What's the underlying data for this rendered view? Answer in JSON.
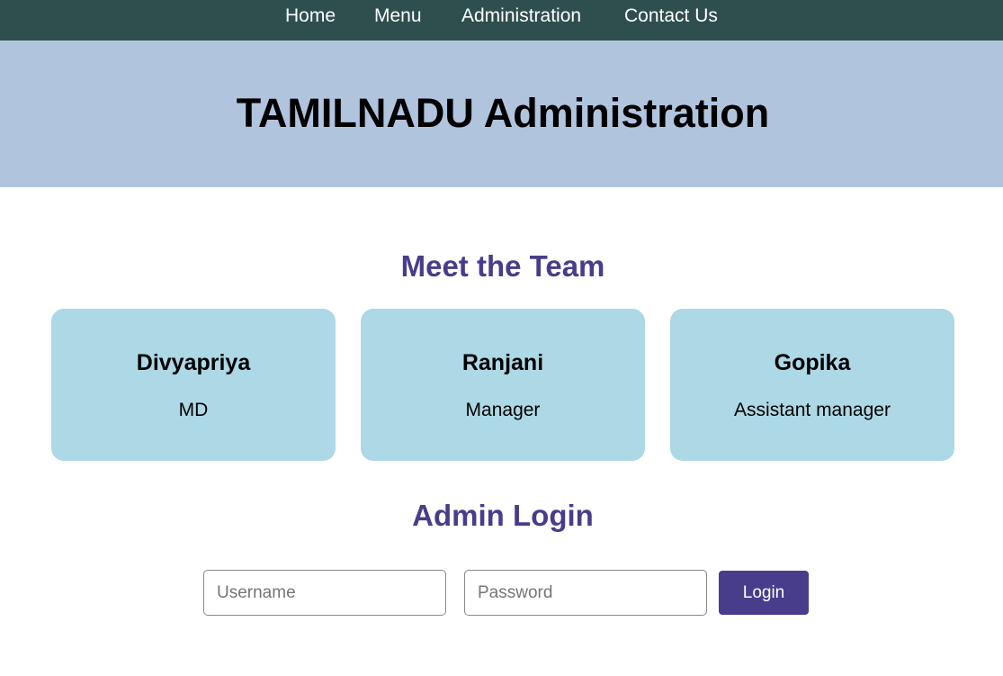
{
  "nav": {
    "items": [
      {
        "label": "Home"
      },
      {
        "label": "Menu"
      },
      {
        "label": "Administration"
      },
      {
        "label": "Contact Us"
      }
    ]
  },
  "hero": {
    "title": "TAMILNADU Administration"
  },
  "team": {
    "title": "Meet the Team",
    "members": [
      {
        "name": "Divyapriya",
        "role": "MD"
      },
      {
        "name": "Ranjani",
        "role": "Manager"
      },
      {
        "name": "Gopika",
        "role": "Assistant manager"
      }
    ]
  },
  "login": {
    "title": "Admin Login",
    "username_placeholder": "Username",
    "password_placeholder": "Password",
    "button_label": "Login"
  },
  "colors": {
    "nav_bg": "#2f4f4f",
    "hero_bg": "#b0c4de",
    "accent": "#483d8b",
    "card_bg": "#add8e6"
  }
}
